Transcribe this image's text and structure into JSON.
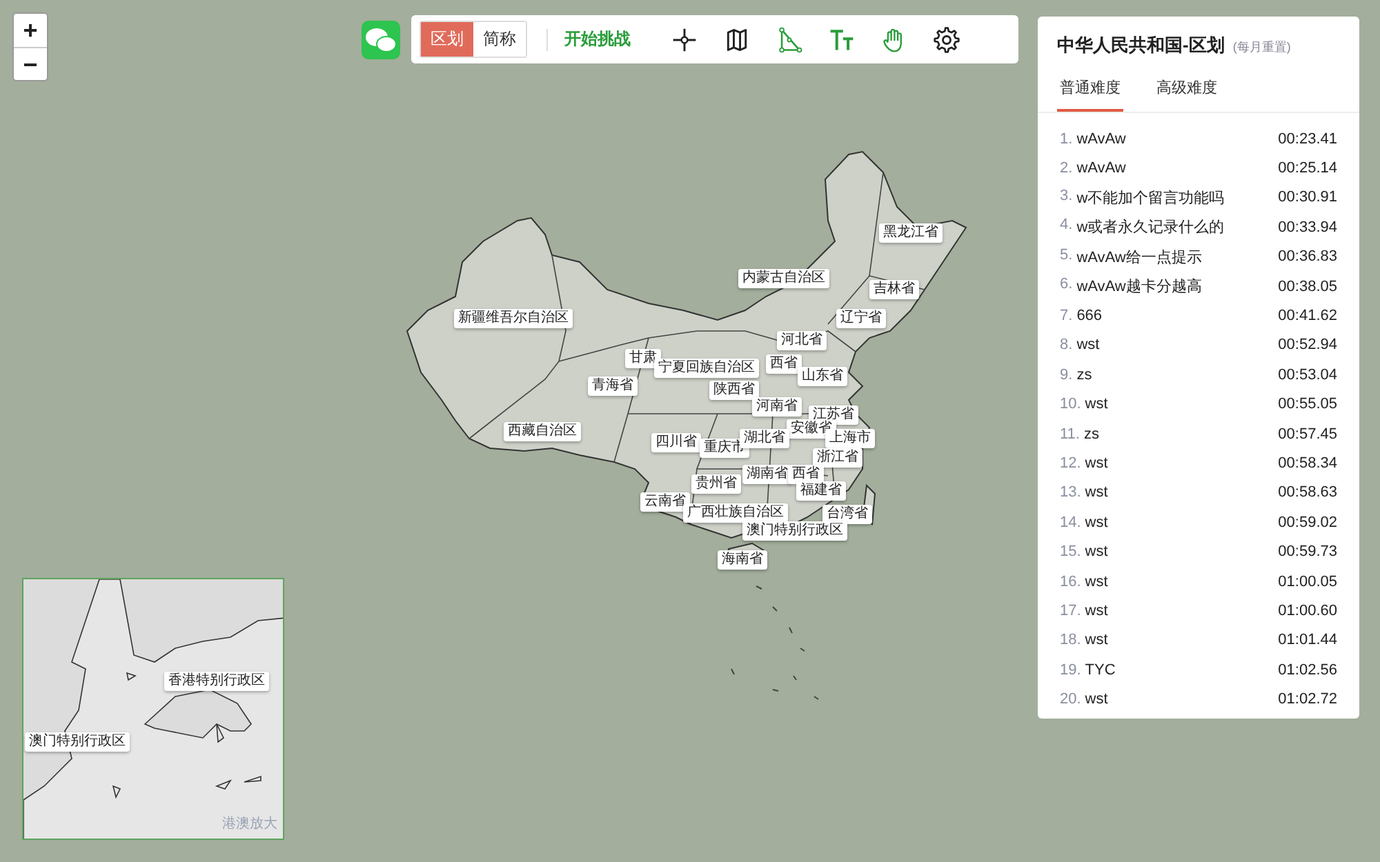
{
  "zoom_controls": [
    {
      "label": "+"
    },
    {
      "label": "−"
    }
  ],
  "toolbar": {
    "modes": [
      {
        "label": "区划",
        "selected": true
      },
      {
        "label": "简称",
        "selected": false
      }
    ],
    "start_label": "开始挑战",
    "tools": [
      {
        "kind": "crosshair"
      },
      {
        "kind": "map"
      },
      {
        "kind": "triangle"
      },
      {
        "kind": "text"
      },
      {
        "kind": "hand"
      },
      {
        "kind": "settings"
      }
    ]
  },
  "map": {
    "labels": [
      {
        "text": "黑龙江省"
      },
      {
        "text": "内蒙古自治区"
      },
      {
        "text": "吉林省"
      },
      {
        "text": "辽宁省"
      },
      {
        "text": "新疆维吾尔自治区"
      },
      {
        "text": "河北省"
      },
      {
        "text": "甘肃"
      },
      {
        "text": "宁夏回族自治区"
      },
      {
        "text": "西省"
      },
      {
        "text": "青海省"
      },
      {
        "text": "山东省"
      },
      {
        "text": "陕西省"
      },
      {
        "text": "河南省"
      },
      {
        "text": "江苏省"
      },
      {
        "text": "安徽省"
      },
      {
        "text": "上海市"
      },
      {
        "text": "西藏自治区"
      },
      {
        "text": "四川省"
      },
      {
        "text": "重庆市"
      },
      {
        "text": "湖北省"
      },
      {
        "text": "浙江省"
      },
      {
        "text": "湖南省"
      },
      {
        "text": "西省"
      },
      {
        "text": "贵州省"
      },
      {
        "text": "福建省"
      },
      {
        "text": "云南省"
      },
      {
        "text": "广西壮族自治区"
      },
      {
        "text": "台湾省"
      },
      {
        "text": "澳门特别行政区"
      },
      {
        "text": "海南省"
      }
    ]
  },
  "inset": {
    "labels": [
      {
        "text": "香港特别行政区"
      },
      {
        "text": "澳门特别行政区"
      }
    ],
    "caption": "港澳放大"
  },
  "leaderboard": {
    "title": "中华人民共和国-区划",
    "note": "(每月重置)",
    "tabs": [
      {
        "label": "普通难度",
        "selected": true
      },
      {
        "label": "高级难度",
        "selected": false
      }
    ],
    "entries": [
      {
        "rank": "1.",
        "name": "wAvAw",
        "time": "00:23.41"
      },
      {
        "rank": "2.",
        "name": "wAvAw",
        "time": "00:25.14"
      },
      {
        "rank": "3.",
        "name": "w不能加个留言功能吗",
        "time": "00:30.91"
      },
      {
        "rank": "4.",
        "name": "w或者永久记录什么的",
        "time": "00:33.94"
      },
      {
        "rank": "5.",
        "name": "wAvAw给一点提示",
        "time": "00:36.83"
      },
      {
        "rank": "6.",
        "name": "wAvAw越卡分越高",
        "time": "00:38.05"
      },
      {
        "rank": "7.",
        "name": "666",
        "time": "00:41.62"
      },
      {
        "rank": "8.",
        "name": "wst",
        "time": "00:52.94"
      },
      {
        "rank": "9.",
        "name": "zs",
        "time": "00:53.04"
      },
      {
        "rank": "10.",
        "name": "wst",
        "time": "00:55.05"
      },
      {
        "rank": "11.",
        "name": "zs",
        "time": "00:57.45"
      },
      {
        "rank": "12.",
        "name": "wst",
        "time": "00:58.34"
      },
      {
        "rank": "13.",
        "name": "wst",
        "time": "00:58.63"
      },
      {
        "rank": "14.",
        "name": "wst",
        "time": "00:59.02"
      },
      {
        "rank": "15.",
        "name": "wst",
        "time": "00:59.73"
      },
      {
        "rank": "16.",
        "name": "wst",
        "time": "01:00.05"
      },
      {
        "rank": "17.",
        "name": "wst",
        "time": "01:00.60"
      },
      {
        "rank": "18.",
        "name": "wst",
        "time": "01:01.44"
      },
      {
        "rank": "19.",
        "name": "TYC",
        "time": "01:02.56"
      },
      {
        "rank": "20.",
        "name": "wst",
        "time": "01:02.72"
      }
    ]
  }
}
